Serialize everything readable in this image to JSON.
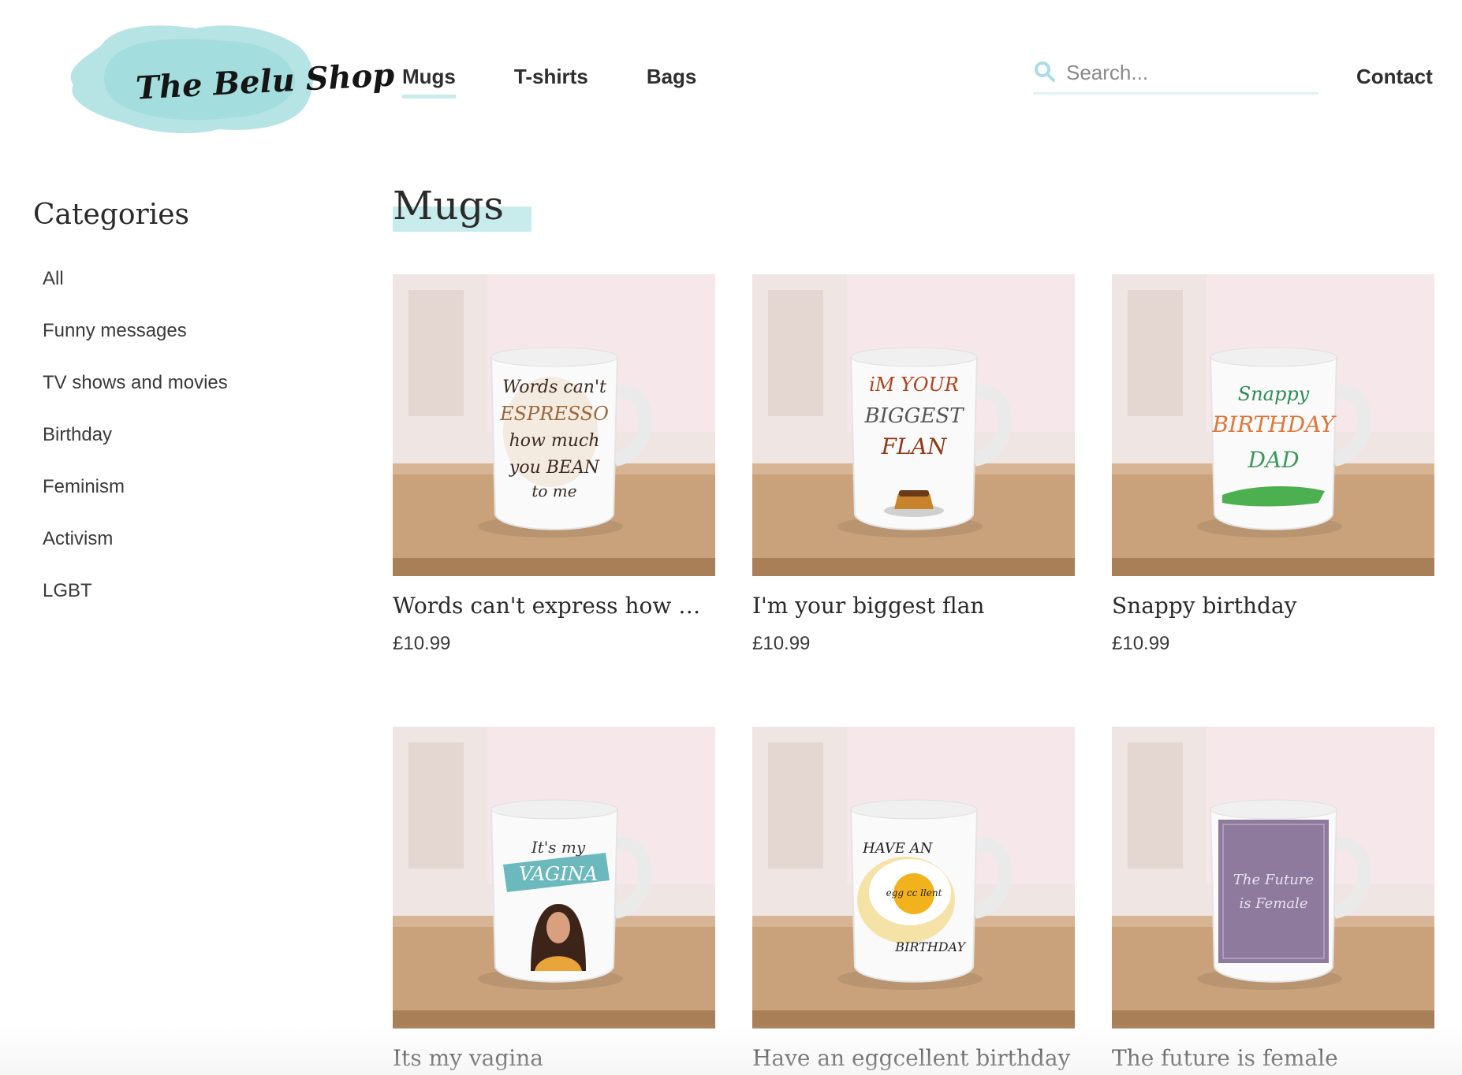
{
  "header": {
    "logo_text": "The Belu Shop",
    "nav": [
      {
        "label": "Mugs",
        "active": true
      },
      {
        "label": "T-shirts",
        "active": false
      },
      {
        "label": "Bags",
        "active": false
      }
    ],
    "search": {
      "placeholder": "Search...",
      "value": ""
    },
    "contact_label": "Contact",
    "accent_color": "#c8ecec"
  },
  "sidebar": {
    "title": "Categories",
    "items": [
      {
        "label": "All"
      },
      {
        "label": "Funny messages"
      },
      {
        "label": "TV shows and movies"
      },
      {
        "label": "Birthday"
      },
      {
        "label": "Feminism"
      },
      {
        "label": "Activism"
      },
      {
        "label": "LGBT"
      }
    ]
  },
  "main": {
    "title": "Mugs",
    "products": [
      {
        "name": "Words can't express how mu...",
        "price": "£10.99",
        "mug_text": [
          "Words can't",
          "ESPRESSO",
          "how much",
          "you BEAN",
          "to me"
        ]
      },
      {
        "name": "I'm your biggest flan",
        "price": "£10.99",
        "mug_text": [
          "iM YOUR",
          "BIGGEST",
          "FLAN"
        ]
      },
      {
        "name": "Snappy birthday",
        "price": "£10.99",
        "mug_text": [
          "Snappy",
          "BIRTHDAY",
          "DAD"
        ]
      },
      {
        "name": "Its my vagina",
        "price": "",
        "mug_text": [
          "It's my",
          "VAGINA"
        ]
      },
      {
        "name": "Have an eggcellent birthday",
        "price": "",
        "mug_text": [
          "HAVE AN",
          "egg cc llent",
          "BIRTHDAY"
        ]
      },
      {
        "name": "The future is female",
        "price": "",
        "mug_text": [
          "The Future",
          "is Female"
        ]
      }
    ]
  }
}
